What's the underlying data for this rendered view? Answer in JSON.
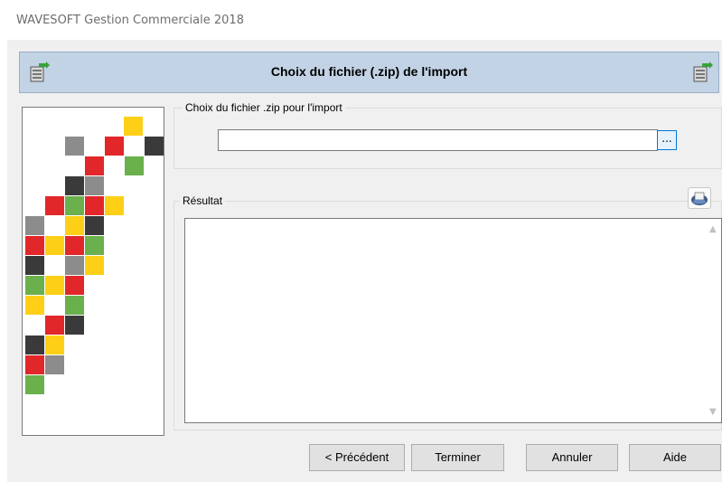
{
  "window": {
    "title": "WAVESOFT Gestion Commerciale 2018"
  },
  "banner": {
    "title": "Choix du fichier (.zip) de l'import",
    "background": "#c2d3e5",
    "left_icon": "archive-export-icon",
    "right_icon": "archive-export-icon"
  },
  "file_group": {
    "label": "Choix du fichier .zip pour l'import",
    "value": "",
    "browse_label": "..."
  },
  "result_group": {
    "label": "Résultat",
    "content": "",
    "print_icon": "printer-icon"
  },
  "buttons": {
    "previous": "< Précédent",
    "finish": "Terminer",
    "cancel": "Annuler",
    "help": "Aide"
  },
  "mosaic_colors": {
    "red": "#e2272a",
    "yellow": "#fdd017",
    "green": "#6ab04c",
    "gray": "#8c8c8c",
    "dark": "#3a3a3a"
  }
}
